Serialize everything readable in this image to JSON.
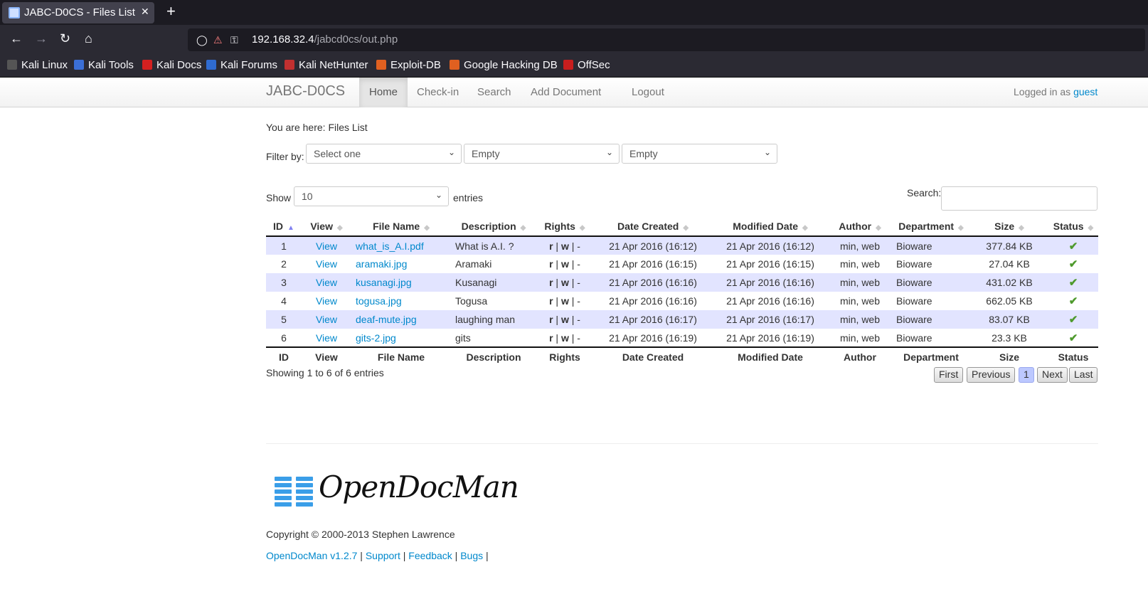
{
  "browser": {
    "tab_title": "JABC-D0CS - Files List",
    "tab_close": "✕",
    "new_tab": "+",
    "url_host": "192.168.32.4",
    "url_path": "/jabcd0cs/out.php",
    "bookmarks": [
      "Kali Linux",
      "Kali Tools",
      "Kali Docs",
      "Kali Forums",
      "Kali NetHunter",
      "Exploit-DB",
      "Google Hacking DB",
      "OffSec"
    ]
  },
  "header": {
    "brand": "JABC-D0CS",
    "menu": [
      "Home",
      "Check-in",
      "Search",
      "Add Document",
      "Logout"
    ],
    "logged_in_prefix": "Logged in as",
    "user": "guest"
  },
  "breadcrumb": "You are here: Files List",
  "filter": {
    "label": "Filter by:",
    "select1": "Select one",
    "select2": "Empty",
    "select3": "Empty"
  },
  "table_controls": {
    "show_label": "Show",
    "entries_value": "10",
    "entries_label": "entries",
    "search_label": "Search:"
  },
  "table": {
    "columns": [
      "ID",
      "View",
      "File Name",
      "Description",
      "Rights",
      "Date Created",
      "Modified Date",
      "Author",
      "Department",
      "Size",
      "Status"
    ],
    "rows": [
      {
        "id": "1",
        "view": "View",
        "file": "what_is_A.I.pdf",
        "desc": "What is A.I. ?",
        "r": "r",
        "w": "w",
        "x": "-",
        "created": "21 Apr 2016 (16:12)",
        "modified": "21 Apr 2016 (16:12)",
        "author": "min, web",
        "dept": "Bioware",
        "size": "377.84 KB"
      },
      {
        "id": "2",
        "view": "View",
        "file": "aramaki.jpg",
        "desc": "Aramaki",
        "r": "r",
        "w": "w",
        "x": "-",
        "created": "21 Apr 2016 (16:15)",
        "modified": "21 Apr 2016 (16:15)",
        "author": "min, web",
        "dept": "Bioware",
        "size": "27.04 KB"
      },
      {
        "id": "3",
        "view": "View",
        "file": "kusanagi.jpg",
        "desc": "Kusanagi",
        "r": "r",
        "w": "w",
        "x": "-",
        "created": "21 Apr 2016 (16:16)",
        "modified": "21 Apr 2016 (16:16)",
        "author": "min, web",
        "dept": "Bioware",
        "size": "431.02 KB"
      },
      {
        "id": "4",
        "view": "View",
        "file": "togusa.jpg",
        "desc": "Togusa",
        "r": "r",
        "w": "w",
        "x": "-",
        "created": "21 Apr 2016 (16:16)",
        "modified": "21 Apr 2016 (16:16)",
        "author": "min, web",
        "dept": "Bioware",
        "size": "662.05 KB"
      },
      {
        "id": "5",
        "view": "View",
        "file": "deaf-mute.jpg",
        "desc": "laughing man",
        "r": "r",
        "w": "w",
        "x": "-",
        "created": "21 Apr 2016 (16:17)",
        "modified": "21 Apr 2016 (16:17)",
        "author": "min, web",
        "dept": "Bioware",
        "size": "83.07 KB"
      },
      {
        "id": "6",
        "view": "View",
        "file": "gits-2.jpg",
        "desc": "gits",
        "r": "r",
        "w": "w",
        "x": "-",
        "created": "21 Apr 2016 (16:19)",
        "modified": "21 Apr 2016 (16:19)",
        "author": "min, web",
        "dept": "Bioware",
        "size": "23.3 KB"
      }
    ],
    "status_icon": "check-icon"
  },
  "pagination": {
    "info": "Showing 1 to 6 of 6 entries",
    "first": "First",
    "previous": "Previous",
    "current": "1",
    "next": "Next",
    "last": "Last"
  },
  "footer": {
    "logo_text": "OpenDocMan",
    "copyright": "Copyright © 2000-2013 Stephen Lawrence",
    "links": [
      "OpenDocMan v1.2.7",
      "Support",
      "Feedback",
      "Bugs"
    ]
  },
  "colors": {
    "link": "#0088cc",
    "row_odd": "#e2e4ff",
    "check": "#4e9a2d",
    "logo_blue": "#3a9ee8"
  }
}
